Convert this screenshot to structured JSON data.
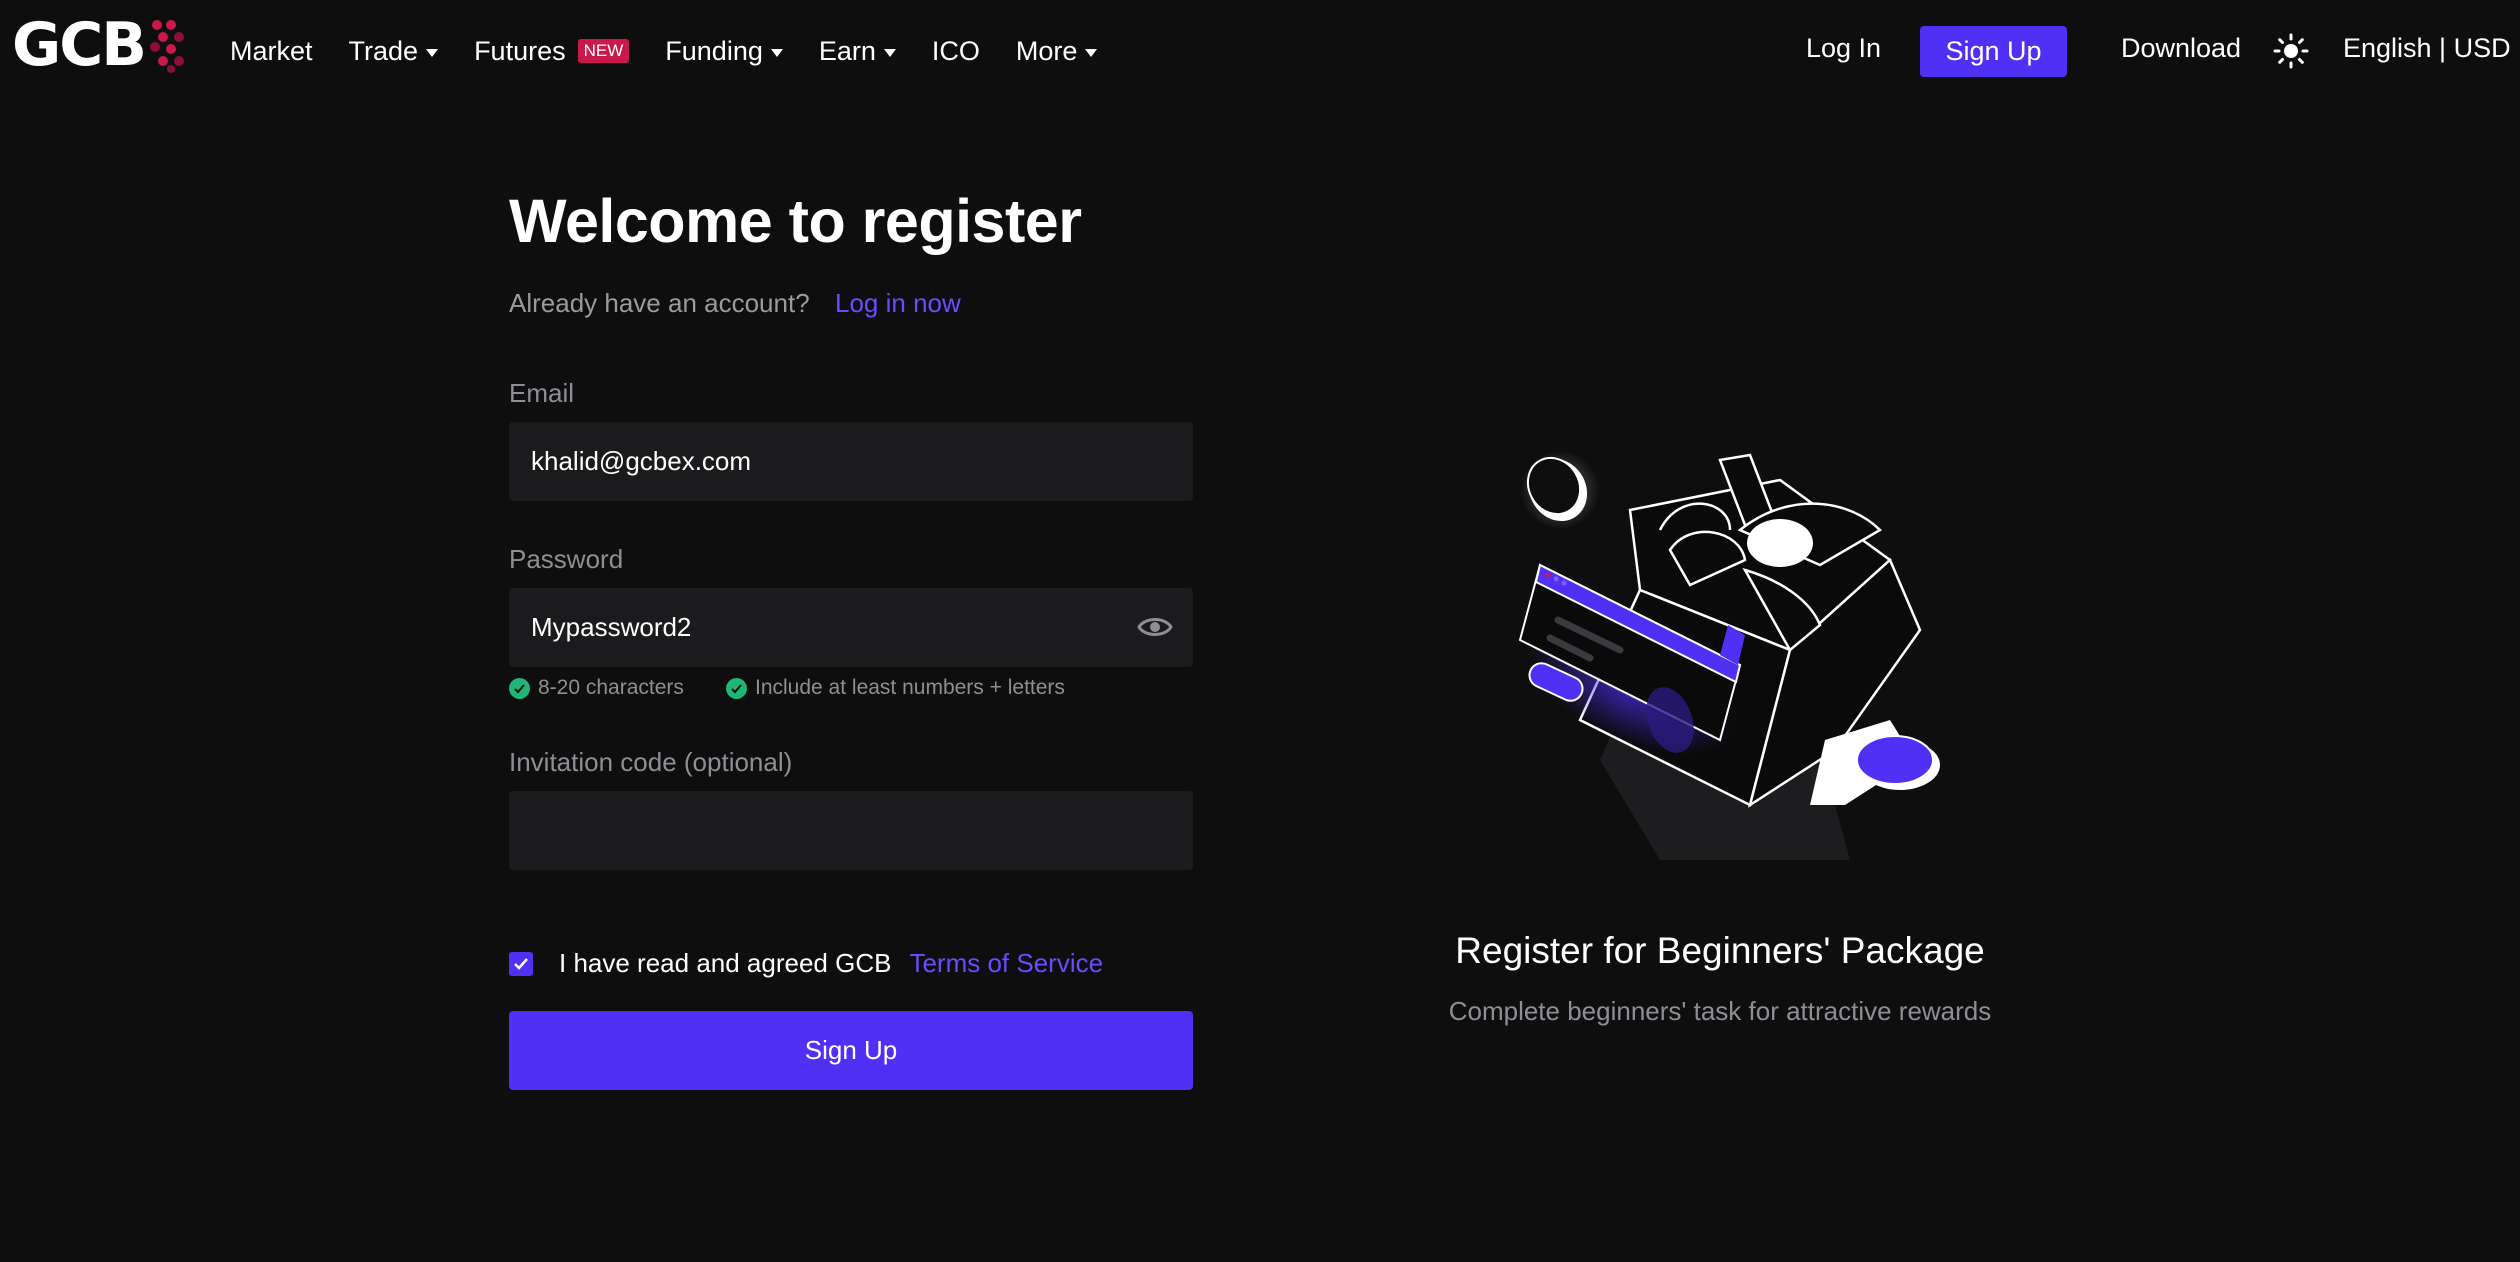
{
  "header": {
    "logo": "GCB",
    "nav": [
      {
        "label": "Market",
        "dropdown": false
      },
      {
        "label": "Trade",
        "dropdown": true
      },
      {
        "label": "Futures",
        "dropdown": false,
        "badge": "NEW"
      },
      {
        "label": "Funding",
        "dropdown": true
      },
      {
        "label": "Earn",
        "dropdown": true
      },
      {
        "label": "ICO",
        "dropdown": false
      },
      {
        "label": "More",
        "dropdown": true
      }
    ],
    "login_label": "Log In",
    "signup_label": "Sign Up",
    "download_label": "Download",
    "theme_icon": "sun-icon",
    "language_currency": "English | USD"
  },
  "form": {
    "title": "Welcome to register",
    "have_account": "Already have an account?",
    "login_link": "Log in now",
    "email": {
      "label": "Email",
      "value": "khalid@gcbex.com"
    },
    "password": {
      "label": "Password",
      "value": "Mypassword2",
      "toggle_icon": "eye-icon"
    },
    "password_hints": [
      {
        "text": "8-20 characters",
        "met": true
      },
      {
        "text": "Include at least numbers + letters",
        "met": true
      }
    ],
    "invitation": {
      "label": "Invitation code (optional)",
      "value": ""
    },
    "agree": {
      "checked": true,
      "text": "I have read and agreed GCB",
      "link": "Terms of Service"
    },
    "submit_label": "Sign Up"
  },
  "promo": {
    "title": "Register for Beginners' Package",
    "subtitle": "Complete beginners' task for attractive rewards"
  },
  "colors": {
    "background": "#0e0e0f",
    "accent": "#5030f5",
    "link": "#6a4cff",
    "input_bg": "#1b1b1d",
    "success": "#20b478",
    "badge": "#c9184a"
  }
}
